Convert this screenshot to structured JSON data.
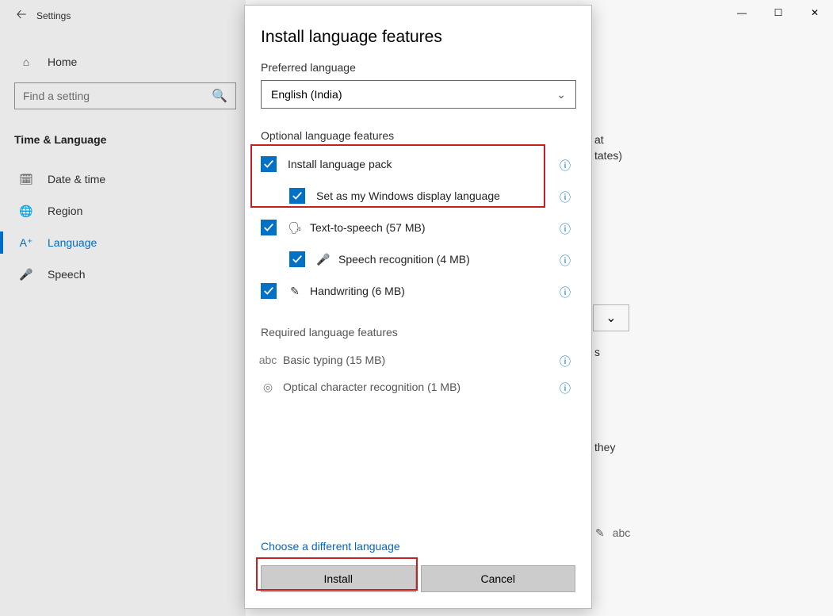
{
  "window": {
    "app_title": "Settings",
    "minimize": "—",
    "maximize": "☐",
    "close": "✕"
  },
  "sidebar": {
    "home_label": "Home",
    "search_placeholder": "Find a setting",
    "category": "Time & Language",
    "items": [
      {
        "label": "Date & time"
      },
      {
        "label": "Region"
      },
      {
        "label": "Language"
      },
      {
        "label": "Speech"
      }
    ]
  },
  "peek": {
    "l1": "at",
    "l2": "tates)",
    "l3": "s",
    "l4": "they"
  },
  "dialog": {
    "title": "Install language features",
    "preferred_label": "Preferred language",
    "preferred_value": "English (India)",
    "optional_label": "Optional language features",
    "features": {
      "install_pack": "Install language pack",
      "set_display": "Set as my Windows display language",
      "tts": "Text-to-speech (57 MB)",
      "speech_rec": "Speech recognition (4 MB)",
      "handwriting": "Handwriting (6 MB)"
    },
    "required_label": "Required language features",
    "required": {
      "basic_typing": "Basic typing (15 MB)",
      "ocr": "Optical character recognition (1 MB)"
    },
    "choose_different": "Choose a different language",
    "install_btn": "Install",
    "cancel_btn": "Cancel"
  }
}
